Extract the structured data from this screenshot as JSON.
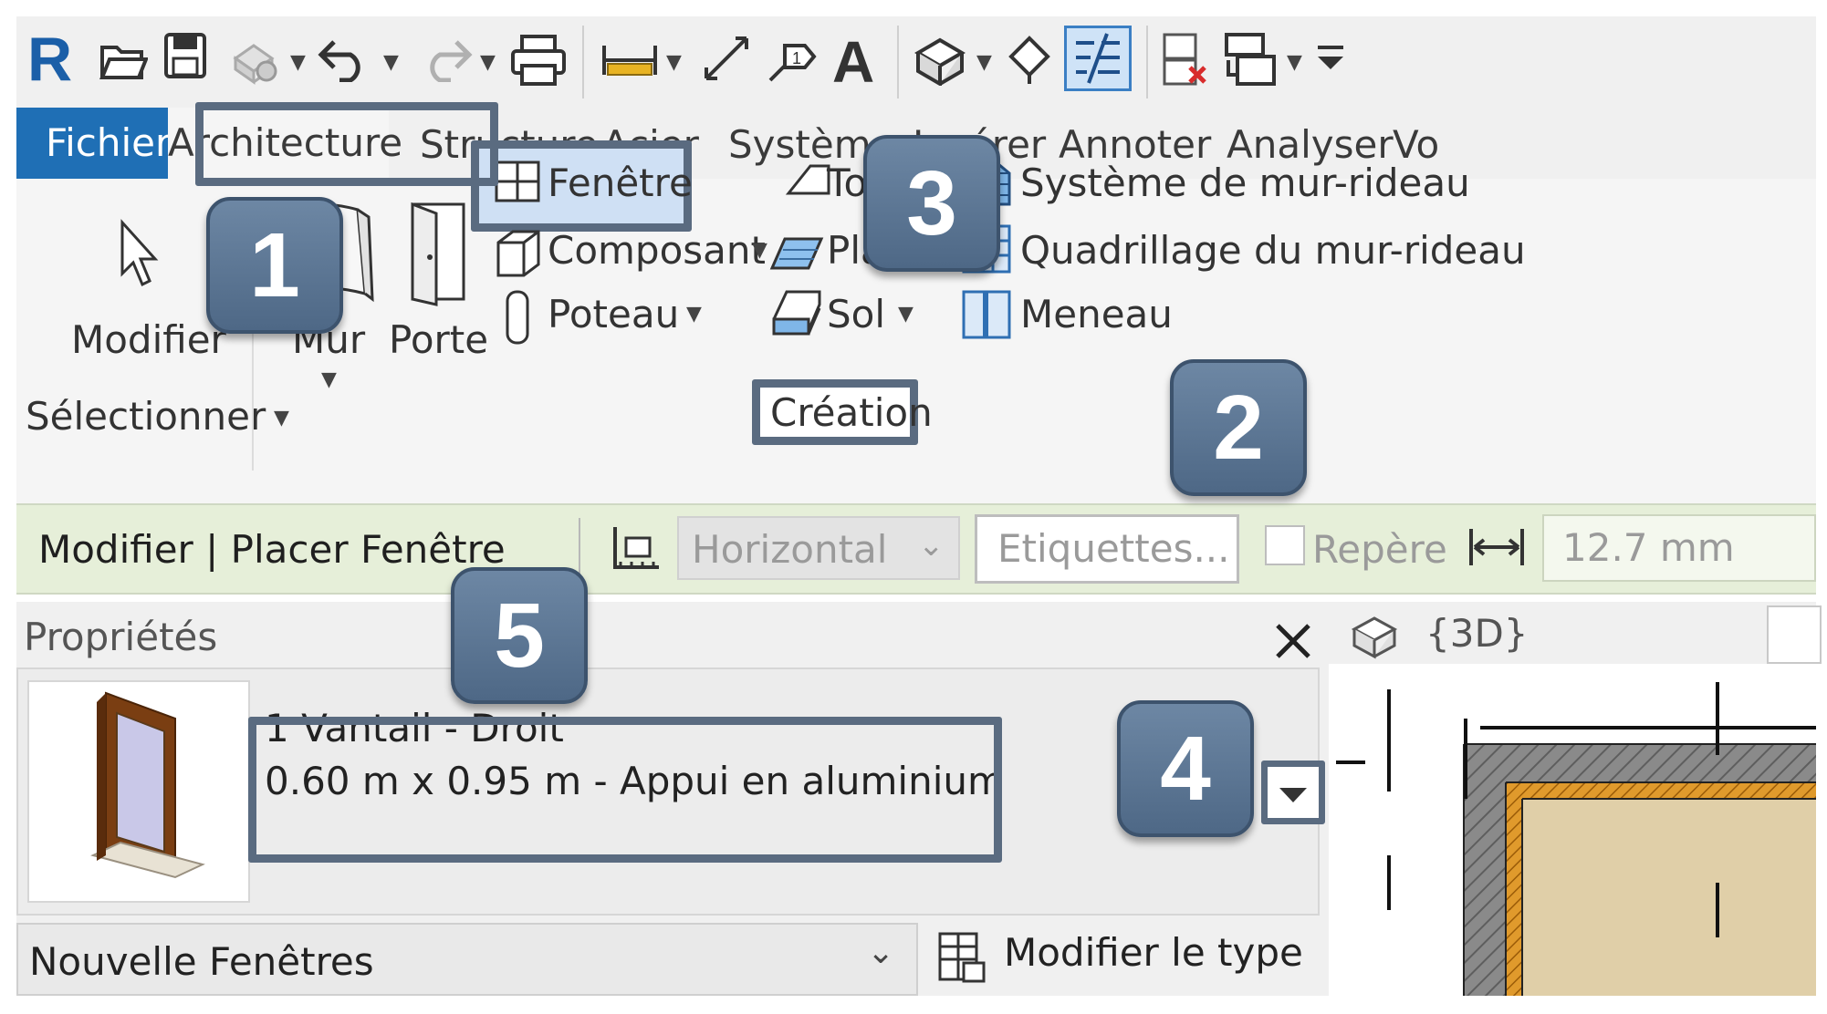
{
  "menu_tabs": {
    "file": "Fichier",
    "items": [
      "Architecture",
      "Structure",
      "Acier",
      "Systèmes",
      "Insérer",
      "Annoter",
      "Analyser",
      "Vo"
    ]
  },
  "ribbon": {
    "modify_label": "Modifier",
    "select_label": "Sélectionner",
    "wall_label": "Mur",
    "door_label": "Porte",
    "window_label": "Fenêtre",
    "component_label": "Composant",
    "column_label": "Poteau",
    "roof_label": "Toit",
    "ceiling_label": "Plafond",
    "floor_label": "Sol",
    "curtain_system_label": "Système de mur-rideau",
    "curtain_grid_label": "Quadrillage du mur-rideau",
    "mullion_label": "Meneau",
    "build_panel_label": "Création"
  },
  "options_bar": {
    "context_label": "Modifier | Placer Fenêtre",
    "orientation_value": "Horizontal",
    "tags_button": "Etiquettes...",
    "leader_label": "Repère",
    "length_value": "12.7 mm"
  },
  "properties": {
    "title": "Propriétés",
    "type_name": "1 Vantail - Droit",
    "type_detail": "0.60 m x 0.95 m - Appui en aluminium",
    "instance_filter": "Nouvelle Fenêtres",
    "edit_type_label": "Modifier le type"
  },
  "view_tab": {
    "label": "{3D}"
  },
  "badges": [
    "1",
    "2",
    "3",
    "4",
    "5"
  ],
  "colors": {
    "file_tab": "#1f6fb5",
    "highlight_border": "#5a6b80",
    "badge_fill": "#5b7593",
    "options_bar_bg": "#e6efd9",
    "wall_hatch": "#808080",
    "insulation": "#d68a1a",
    "floor_fill": "#e0cfa8"
  },
  "icons": [
    "revit-logo-icon",
    "open-icon",
    "save-icon",
    "sync-icon",
    "undo-icon",
    "redo-icon",
    "print-icon",
    "measure-icon",
    "dimension-icon",
    "tag-icon",
    "text-icon",
    "3d-view-icon",
    "section-icon",
    "thin-lines-icon",
    "close-hidden-icon",
    "switch-windows-icon",
    "customize-qat-icon"
  ]
}
